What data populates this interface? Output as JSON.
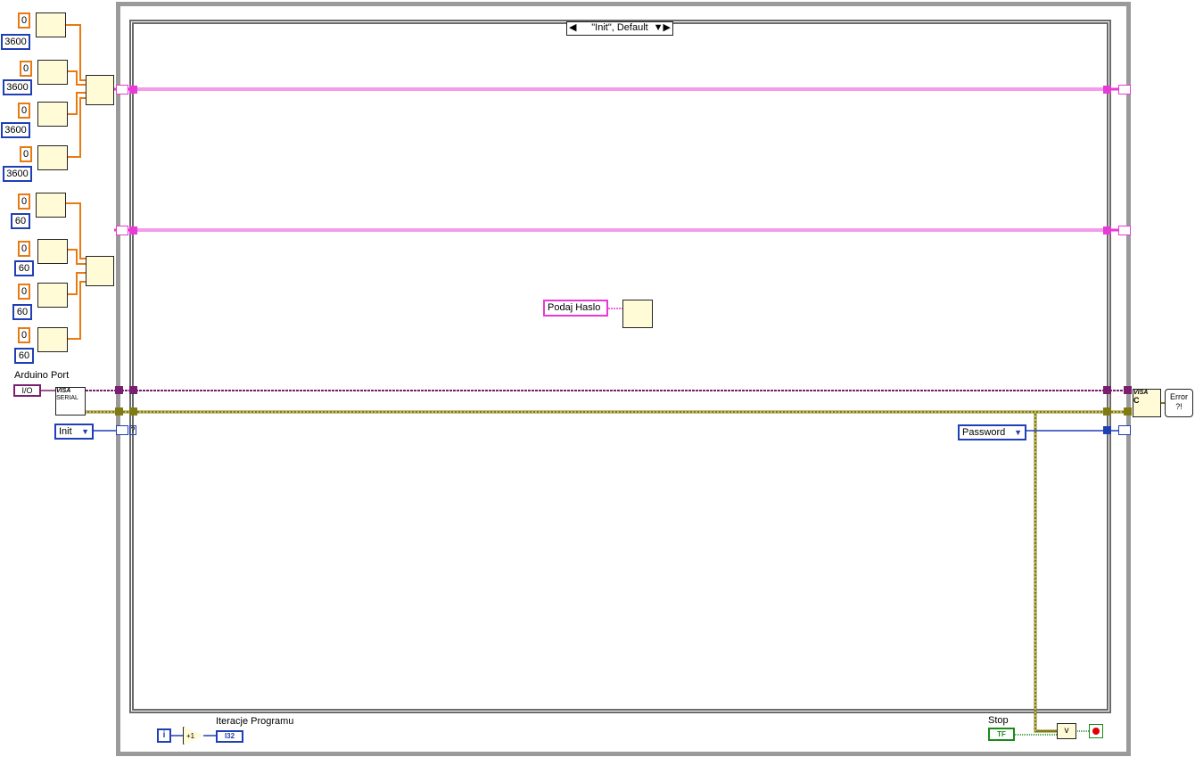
{
  "constants": {
    "zero": "0",
    "group1": [
      "3600",
      "3600",
      "3600",
      "3600"
    ],
    "group2": [
      "60",
      "60",
      "60",
      "60"
    ]
  },
  "arduino_port": {
    "label": "Arduino Port",
    "value": "I/O"
  },
  "visa_node": {
    "text1": "VISA",
    "text2": "SERIAL"
  },
  "case_selector": "\"Init\", Default",
  "init_enum": "Init",
  "password_enum": "Password",
  "podaj_haslo": "Podaj Haslo",
  "iteration": {
    "label": "Iteracje Programu",
    "i": "i",
    "increment": "+1",
    "type": "I32"
  },
  "stop": {
    "label": "Stop",
    "value": "TF",
    "or": "v"
  },
  "close_node": {
    "text": "VISA",
    "sub": "C"
  },
  "error_node": "Error\n?!",
  "unknown_tunnel": "?",
  "colors": {
    "orange": "#e87a12",
    "blue": "#1f3fb5",
    "pink": "#e83ad6",
    "purple": "#7a1f70",
    "olive": "#807a14",
    "frame": "#9a9a9a",
    "green": "#1a8a1a"
  }
}
